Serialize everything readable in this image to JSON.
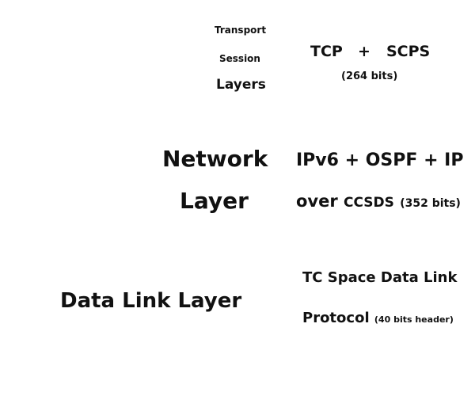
{
  "transport_session": {
    "transport": "Transport",
    "session": "Session",
    "layers": "Layers",
    "protocol_left": "TCP",
    "plus": "+",
    "protocol_right": "SCPS",
    "bits": "(264 bits)"
  },
  "network": {
    "title_line1": "Network",
    "title_line2": "Layer",
    "protocols": "IPv6 + OSPF + IP",
    "over_word": "over",
    "over_target": "CCSDS",
    "bits": "(352 bits)"
  },
  "datalink": {
    "title": "Data Link Layer",
    "protocol_line1": "TC Space Data Link",
    "protocol_line2": "Protocol",
    "header_bits": "(40 bits header)"
  }
}
